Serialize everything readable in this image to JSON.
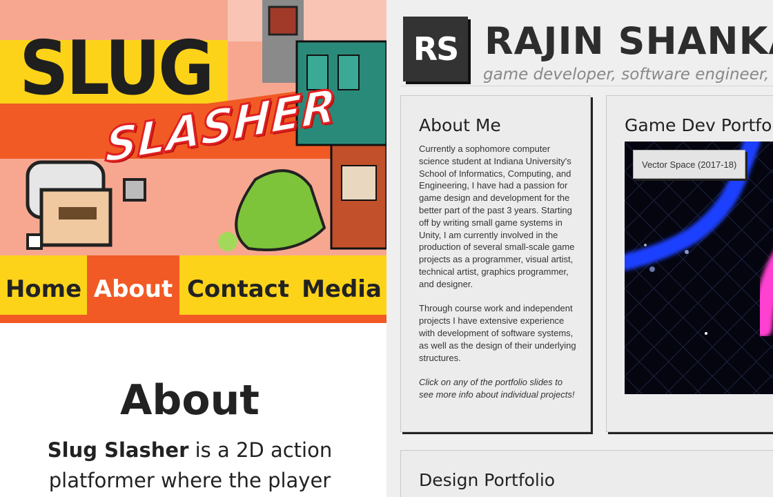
{
  "slug_site": {
    "logo": {
      "line1": "SLUG",
      "line2": "SLASHER"
    },
    "nav": [
      {
        "label": "Home",
        "active": false
      },
      {
        "label": "About",
        "active": true
      },
      {
        "label": "Contact",
        "active": false
      },
      {
        "label": "Media",
        "active": false
      }
    ],
    "about": {
      "heading": "About",
      "game_name": "Slug Slasher",
      "text": " is a 2D action platformer where the player"
    }
  },
  "portfolio_site": {
    "logo": "RS",
    "name": "RAJIN SHANKAR",
    "tagline": "game developer, software engineer, designer",
    "about_card": {
      "title": "About Me",
      "paragraphs": [
        "Currently a sophomore computer science student at Indiana University's School of Informatics, Computing, and Engineering, I have had a passion for game design and development for the better part of the past 3 years. Starting off by writing small game systems in Unity, I am currently involved in the production of several small-scale game projects as a programmer, visual artist, technical artist, graphics programmer, and designer.",
        "Through course work and independent projects I have extensive experience with development of software systems, as well as the design of their underlying structures."
      ],
      "note": "Click on any of the portfolio slides to see more info about individual projects!"
    },
    "gamedev_card": {
      "title": "Game Dev Portfolio",
      "slide_label": "Vector Space (2017-18)"
    },
    "design_card": {
      "title": "Design Portfolio"
    }
  },
  "colors": {
    "slug_yellow": "#fdd31a",
    "slug_orange": "#f15a24",
    "slug_salmon": "#f7a790",
    "portfolio_bg": "#efefef",
    "portfolio_dark": "#333333",
    "neon_blue": "#1e40ff",
    "neon_pink": "#ff3fd0"
  }
}
